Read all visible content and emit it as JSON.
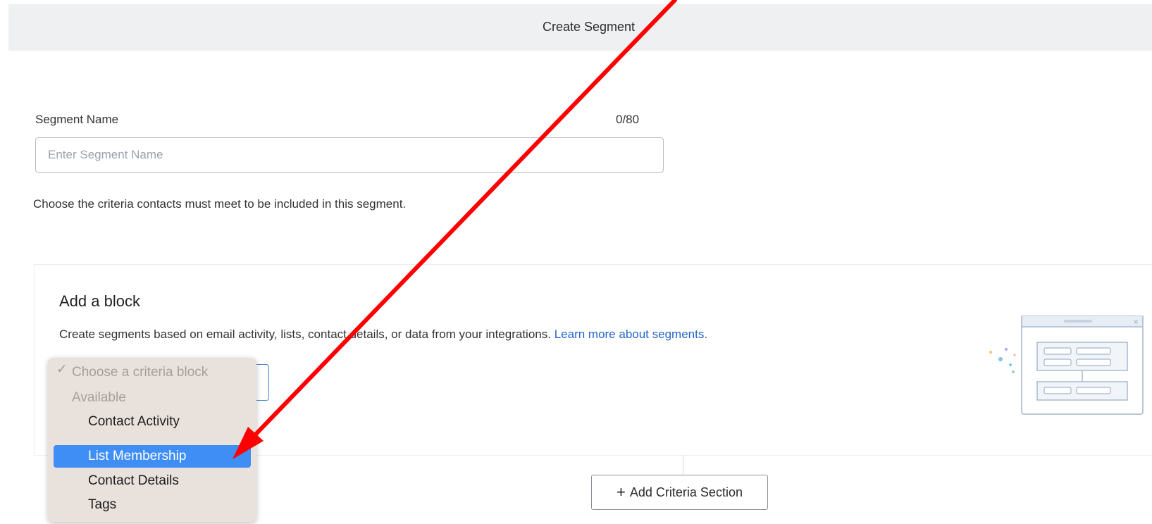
{
  "header": {
    "title": "Create Segment"
  },
  "segment_name": {
    "label": "Segment Name",
    "char_count": "0/80",
    "value": "",
    "placeholder": "Enter Segment Name"
  },
  "criteria_instruction": "Choose the criteria contacts must meet to be included in this segment.",
  "block": {
    "title": "Add a block",
    "description": "Create segments based on email activity, lists, contact details, or data from your integrations.",
    "link_text": "Learn more about segments."
  },
  "criteria_dropdown": {
    "check_glyph": "✓",
    "selected_placeholder": "Choose a criteria block",
    "group_label": "Available",
    "options": [
      "Contact Activity",
      "List Membership",
      "Contact Details",
      "Tags"
    ],
    "highlighted_option": "List Membership"
  },
  "add_criteria_button": {
    "plus_glyph": "+",
    "label": "Add Criteria Section"
  },
  "colors": {
    "header_bg": "#eef0f2",
    "link": "#2466c9",
    "highlight": "#3f8ef5",
    "dropdown_bg": "#e9e1dc",
    "annotation_arrow": "#ff0000"
  },
  "icons": {
    "plus": "plus-icon",
    "check": "check-icon",
    "illustration": "segment-builder-illustration"
  }
}
